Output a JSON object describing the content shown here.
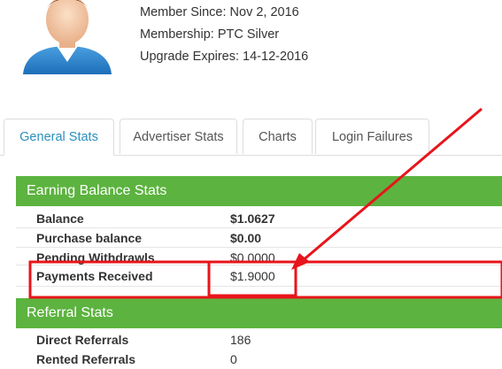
{
  "profile": {
    "member_since": "Member Since: Nov 2, 2016",
    "membership": "Membership: PTC Silver",
    "upgrade_expires": "Upgrade Expires: 14-12-2016"
  },
  "tabs": [
    {
      "label": "General Stats",
      "active": true
    },
    {
      "label": "Advertiser Stats",
      "active": false
    },
    {
      "label": "Charts",
      "active": false
    },
    {
      "label": "Login Failures",
      "active": false
    }
  ],
  "earning": {
    "title": "Earning Balance Stats",
    "rows": [
      {
        "label": "Balance",
        "value": "$1.0627"
      },
      {
        "label": "Purchase balance",
        "value": "$0.00"
      },
      {
        "label": "Pending Withdrawls",
        "value": "$0.0000"
      },
      {
        "label": "Payments Received",
        "value": "$1.9000"
      }
    ]
  },
  "referral": {
    "title": "Referral Stats",
    "rows": [
      {
        "label": "Direct Referrals",
        "value": "186"
      },
      {
        "label": "Rented Referrals",
        "value": "0"
      }
    ]
  },
  "colors": {
    "accent_green": "#5cb33f",
    "annotation_red": "#e8141b",
    "tab_active_text": "#2a8fbd"
  },
  "icons": [
    "user-avatar-icon",
    "annotation-arrow"
  ]
}
